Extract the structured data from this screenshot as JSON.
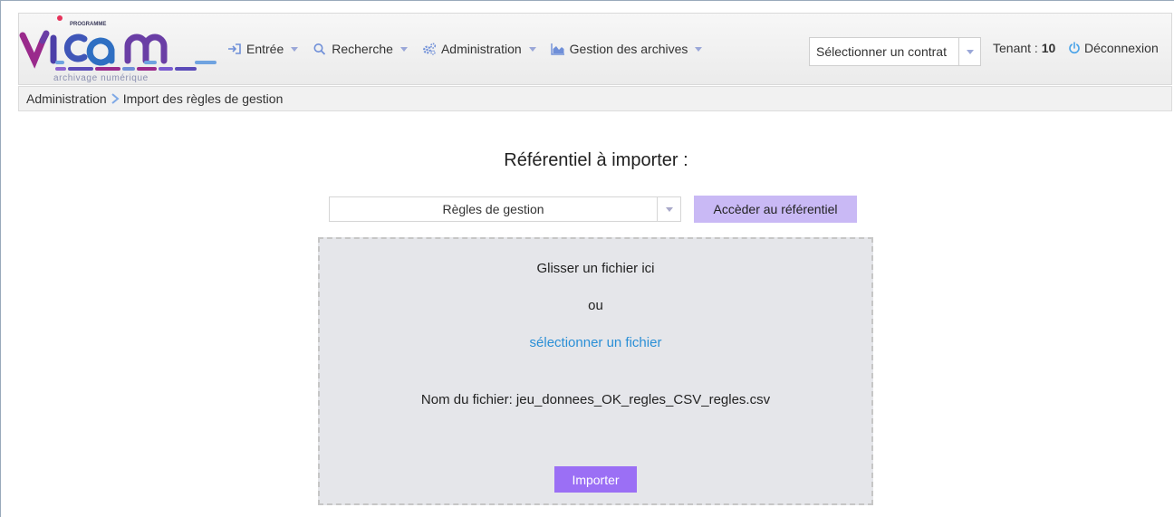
{
  "header": {
    "logo": {
      "tag": "PROGRAMME",
      "name": "vitam",
      "subtitle": "archivage numérique"
    },
    "nav": [
      {
        "label": "Entrée",
        "icon": "sign-in-icon"
      },
      {
        "label": "Recherche",
        "icon": "search-icon"
      },
      {
        "label": "Administration",
        "icon": "gears-icon"
      },
      {
        "label": "Gestion des archives",
        "icon": "area-chart-icon"
      }
    ],
    "contract": {
      "value": "Sélectionner un contrat"
    },
    "tenant": {
      "label": "Tenant :",
      "value": "10"
    },
    "logout": {
      "label": "Déconnexion",
      "icon": "power-icon"
    }
  },
  "breadcrumb": {
    "items": [
      "Administration",
      "Import des règles de gestion"
    ]
  },
  "main": {
    "title": "Référentiel à importer :",
    "referential_select": {
      "value": "Règles de gestion"
    },
    "access_button": "Accèder au référentiel",
    "dropzone": {
      "drop_text": "Glisser un fichier ici",
      "or_text": "ou",
      "select_link": "sélectionner un fichier",
      "filename_label": "Nom du fichier: jeu_donnees_OK_regles_CSV_regles.csv",
      "import_button": "Importer"
    }
  },
  "colors": {
    "accent_purple": "#9b6ff5",
    "access_button": "#c9b9f5",
    "link_blue": "#2a8fd6",
    "nav_icon_blue": "#6f8fd8",
    "logout_icon": "#4aa3e8"
  }
}
